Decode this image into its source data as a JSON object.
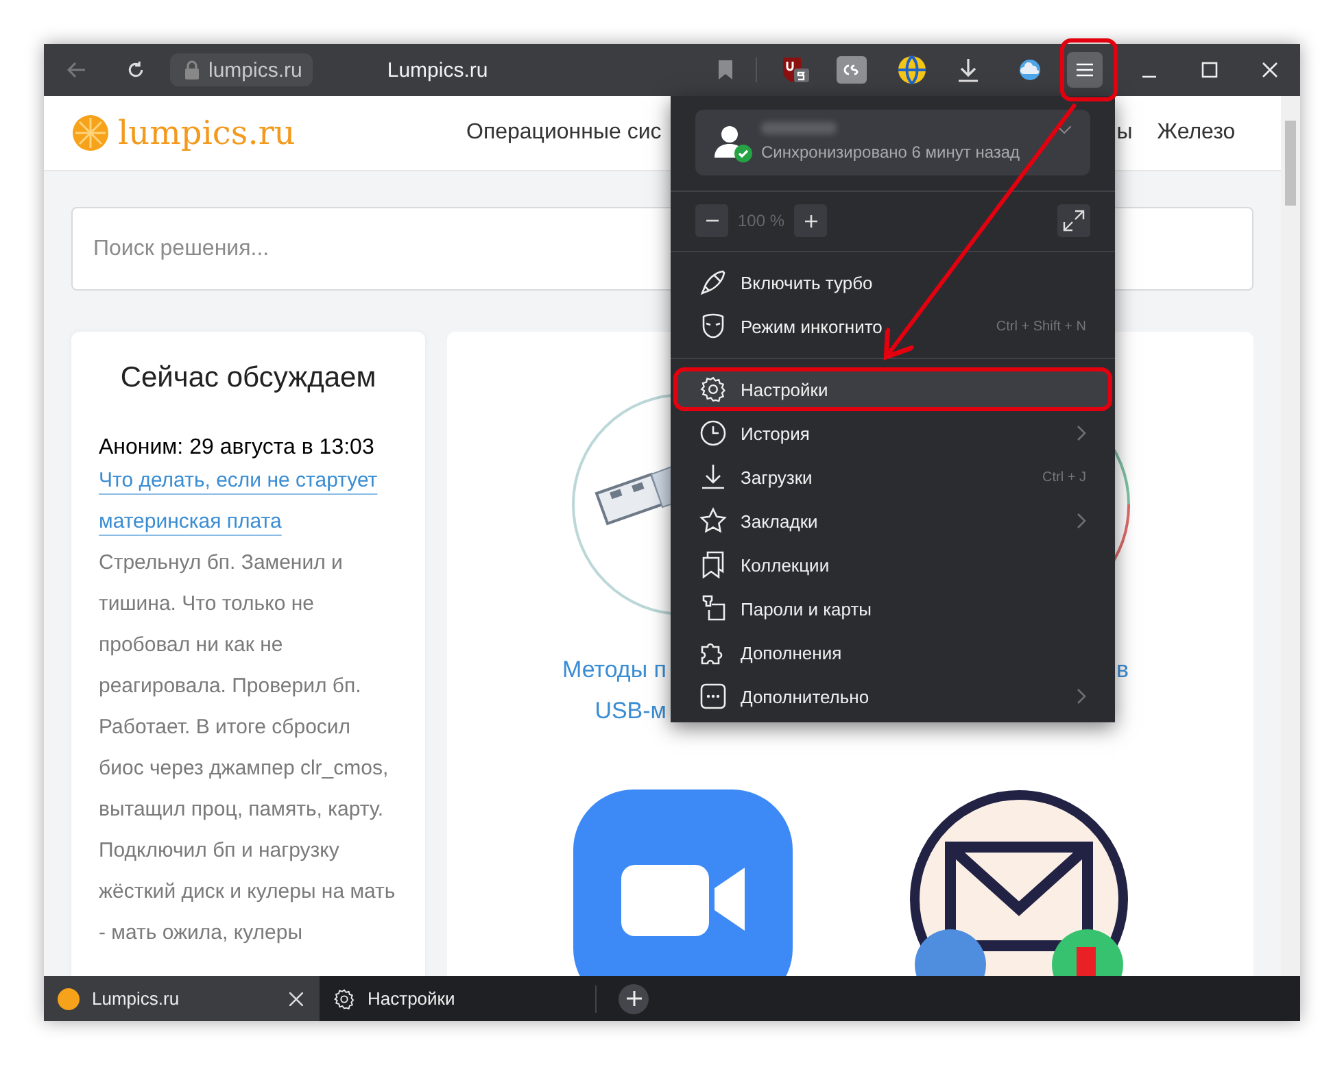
{
  "titlebar": {
    "address": "lumpics.ru",
    "page_title": "Lumpics.ru"
  },
  "site": {
    "logo": "lumpics.ru",
    "nav": [
      "Операционные сис",
      "ы",
      "Железо"
    ],
    "search": {
      "placeholder": "Поиск решения..."
    },
    "discussion": {
      "title": "Сейчас обсуждаем",
      "author": "Аноним: 29 августа в 13:03",
      "link": "Что делать, если не стартует материнская плата",
      "comment": "Стрельнул бп. Заменил и тишина. Что только не пробовал ни как не реагировала. Проверил бп. Работает. В итоге сбросил биос через джампер clr_cmos, вытащил проц, память, карту. Подключил бп и нагрузку жёсткий диск и кулеры на мать - мать ожила, кулеры"
    },
    "articles": [
      {
        "title_lines": [
          "Методы п",
          "USB-м"
        ]
      },
      {
        "title_lines": [
          "в"
        ]
      }
    ]
  },
  "menu": {
    "account": {
      "status": "Синхронизировано 6 минут назад"
    },
    "zoom": "100 %",
    "items": [
      {
        "label": "Включить турбо",
        "selected": false,
        "submenu": false
      },
      {
        "label": "Режим инкогнито",
        "shortcut": "Ctrl + Shift + N",
        "selected": false,
        "submenu": false
      },
      {
        "label": "Настройки",
        "selected": true,
        "submenu": false
      },
      {
        "label": "История",
        "selected": false,
        "submenu": true
      },
      {
        "label": "Загрузки",
        "shortcut": "Ctrl + J",
        "selected": false,
        "submenu": false
      },
      {
        "label": "Закладки",
        "selected": false,
        "submenu": true
      },
      {
        "label": "Коллекции",
        "selected": false,
        "submenu": false
      },
      {
        "label": "Пароли и карты",
        "selected": false,
        "submenu": false
      },
      {
        "label": "Дополнения",
        "selected": false,
        "submenu": false
      },
      {
        "label": "Дополнительно",
        "selected": false,
        "submenu": true
      }
    ]
  },
  "tabs": [
    {
      "label": "Lumpics.ru",
      "selected": true
    },
    {
      "label": "Настройки",
      "selected": false
    }
  ]
}
